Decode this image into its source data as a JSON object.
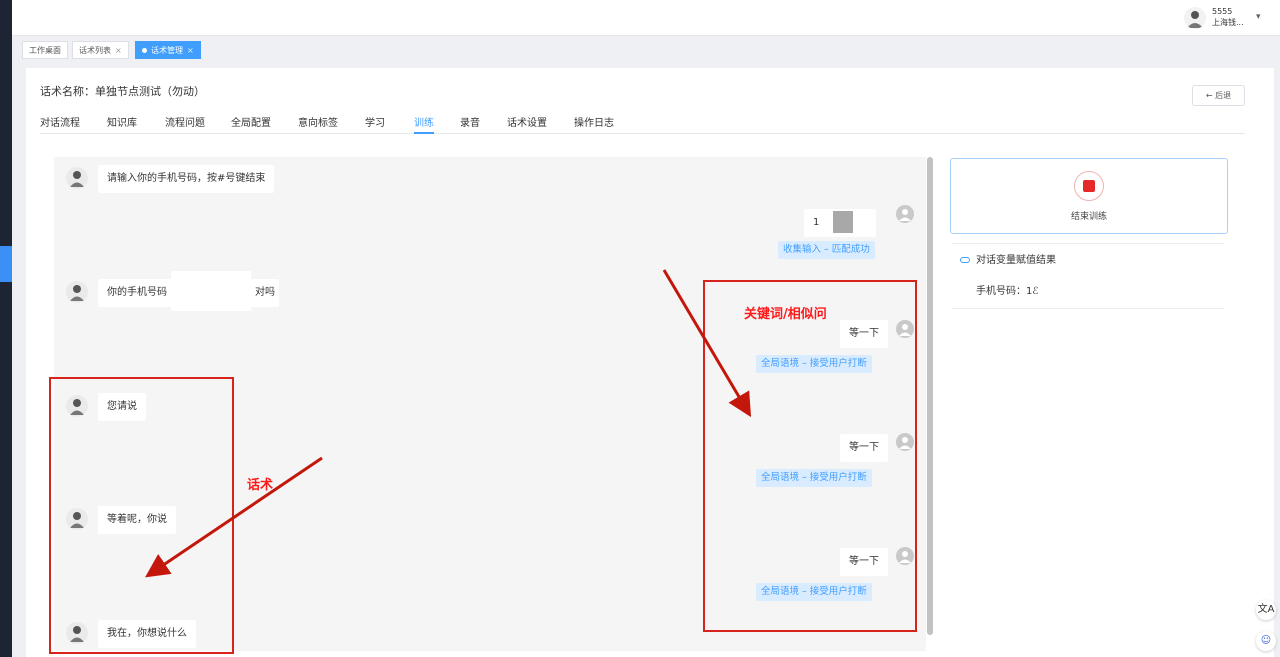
{
  "header": {
    "user_name": "5555",
    "user_company": "上海钱...",
    "caret": "▾"
  },
  "tabs": [
    {
      "label": "工作桌面",
      "closable": false,
      "active": false
    },
    {
      "label": "话术列表",
      "closable": true,
      "active": false
    },
    {
      "label": "话术管理",
      "closable": true,
      "active": true
    }
  ],
  "tab_close": "×",
  "page": {
    "title": "话术名称：单独节点测试（勿动）",
    "back_label": "← 后退",
    "nav": [
      "对话流程",
      "知识库",
      "流程问题",
      "全局配置",
      "意向标签",
      "学习",
      "训练",
      "录音",
      "话术设置",
      "操作日志"
    ],
    "nav_active": "训练"
  },
  "chat": {
    "bot_messages": [
      "请输入你的手机号码，按#号键结束",
      "你的手机号码",
      "您请说",
      "等着呢，你说",
      "我在，你想说什么"
    ],
    "bot_msg2_suffix": "对吗",
    "user_messages": [
      "等一下",
      "等一下",
      "等一下"
    ],
    "user_first_prefix": "1",
    "tags": [
      "收集输入 – 匹配成功",
      "全局语境 – 接受用户打断",
      "全局语境 – 接受用户打断",
      "全局语境 – 接受用户打断"
    ]
  },
  "annotations": {
    "script_label": "话术",
    "keyword_label": "关键词/相似问",
    "color": "#ff1a1a"
  },
  "right": {
    "end_training": "结束训练",
    "var_title": "对话变量赋值结果",
    "var_item": "手机号码：1ℰ"
  },
  "floating": {
    "translate": "文A",
    "chat": "☺"
  },
  "colors": {
    "accent": "#409eff",
    "record": "#e62828",
    "sidebar": "#1d2433"
  }
}
